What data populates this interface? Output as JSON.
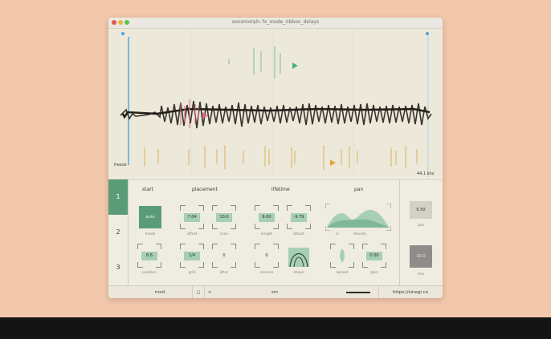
{
  "window": {
    "title": "sonomorph: fx_mode_ribbon_delays"
  },
  "waveform": {
    "left_label": "freeze",
    "right_label": "44.1 khz"
  },
  "tabs": [
    "1",
    "2",
    "3"
  ],
  "sections": {
    "start": "start",
    "placement": "placement",
    "lifetime": "lifetime",
    "pan": "pan"
  },
  "controls": {
    "mode": {
      "value": "auto",
      "label": "mode"
    },
    "offset": {
      "value": "7.04",
      "label": "offset"
    },
    "scan": {
      "value": "10.0",
      "label": "scan"
    },
    "length": {
      "value": "9.00",
      "label": "length"
    },
    "attack": {
      "value": "-9.79",
      "label": "attack"
    },
    "density_left": {
      "value": "G",
      "label": ""
    },
    "density": {
      "label": "density"
    },
    "position": {
      "value": "8.6",
      "label": "position"
    },
    "grid": {
      "value": "1/4",
      "label": "grid"
    },
    "jitter": {
      "value": "0",
      "label": "jitter"
    },
    "reverse": {
      "value": "0",
      "label": "reverse"
    },
    "shape": {
      "label": "shape"
    },
    "spread": {
      "label": "spread"
    },
    "gain": {
      "value": "0.00",
      "label": "gain"
    }
  },
  "right_panel": {
    "pan": {
      "value": "0.50",
      "label": "pan"
    },
    "mix": {
      "value": "10.0",
      "label": "mix"
    }
  },
  "footer": {
    "mode": "mod",
    "toggle": "◻",
    "prev": "<",
    "center": "sm",
    "next": ">",
    "url": "https://sinegi.co"
  }
}
